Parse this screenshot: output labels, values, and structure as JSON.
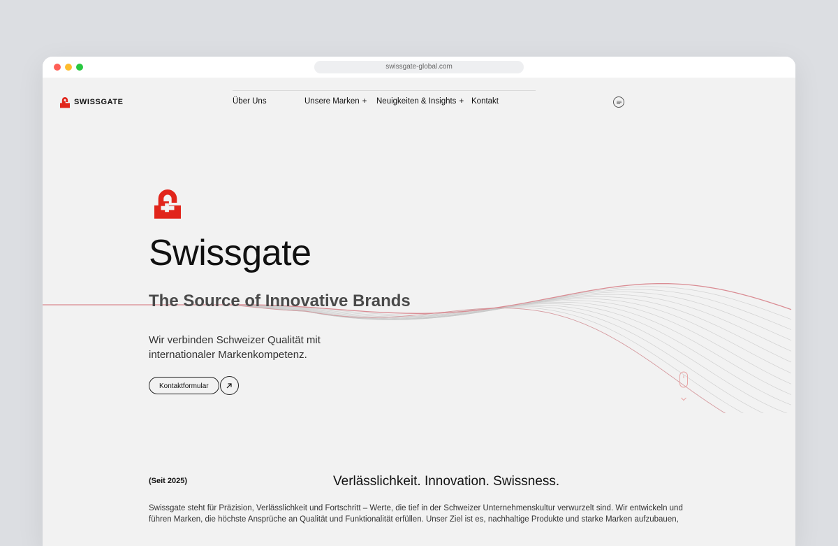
{
  "browser": {
    "url": "swissgate-global.com"
  },
  "header": {
    "brand": "SWISSGATE",
    "nav": [
      {
        "label": "Über Uns",
        "plus": ""
      },
      {
        "label": "Unsere Marken",
        "plus": "+"
      },
      {
        "label": "Neuigkeiten & Insights",
        "plus": "+"
      },
      {
        "label": "Kontakt",
        "plus": ""
      }
    ],
    "language_icon": "chat-bubble-icon"
  },
  "hero": {
    "title": "Swissgate",
    "subtitle": "The Source of Innovative Brands",
    "description": "Wir verbinden Schweizer Qualität mit internationaler Markenkompetenz.",
    "cta_label": "Kontaktformular",
    "cta_icon": "arrow-up-right-icon"
  },
  "about": {
    "since": "(Seit 2025)",
    "tagline": "Verlässlichkeit. Innovation. Swissness.",
    "text": "Swissgate steht für Präzision, Verlässlichkeit und Fortschritt – Werte, die tief in der Schweizer Unternehmenskultur verwurzelt sind. Wir entwickeln und führen Marken, die höchste Ansprüche an Qualität und Funktionalität erfüllen. Unser Ziel ist es, nachhaltige Produkte und starke Marken aufzubauen,"
  },
  "colors": {
    "brand_red": "#e1251b",
    "wave_red": "#d9848c",
    "wave_grey": "#c8c8c8",
    "page_bg": "#f2f2f2"
  }
}
